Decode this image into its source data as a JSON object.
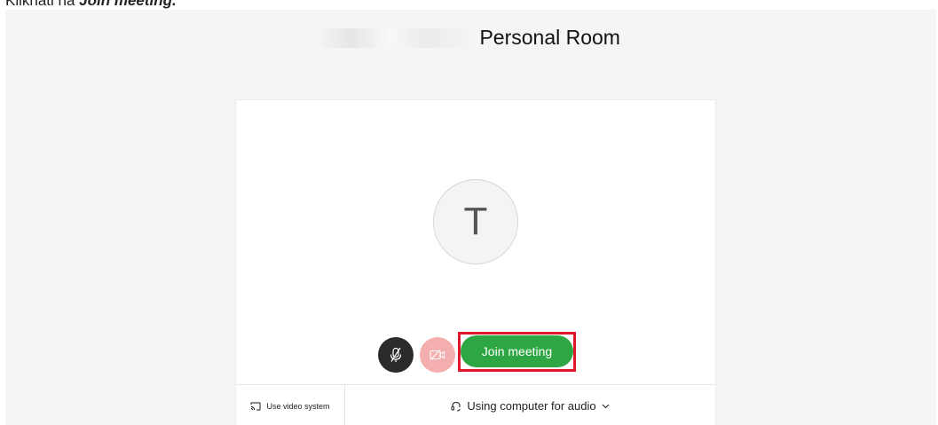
{
  "instruction": {
    "prefix": "Klikhati na ",
    "emphasis": "Join meeting."
  },
  "header": {
    "title": "Personal Room"
  },
  "preview": {
    "avatar_initial": "T"
  },
  "controls": {
    "mic_icon": "mic-muted-icon",
    "video_icon": "video-off-icon",
    "join_label": "Join meeting",
    "join_color": "#2fa644",
    "highlight_color": "#e0162b"
  },
  "footer": {
    "video_system_label": "Use video system",
    "audio_label": "Using computer for audio"
  }
}
